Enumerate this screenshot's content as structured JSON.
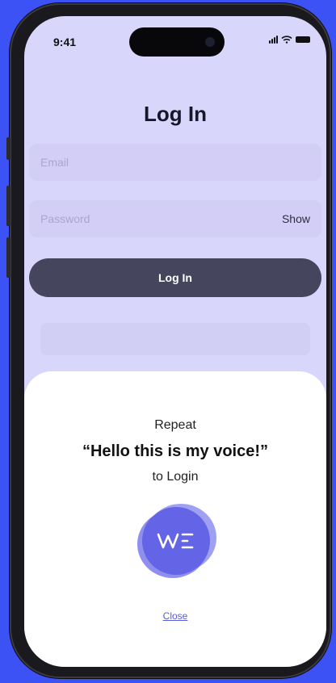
{
  "status_bar": {
    "time": "9:41"
  },
  "page": {
    "title": "Log In"
  },
  "form": {
    "email_placeholder": "Email",
    "password_placeholder": "Password",
    "show_label": "Show",
    "login_label": "Log In"
  },
  "voice_sheet": {
    "repeat_text": "Repeat",
    "phrase": "“Hello this is my voice!”",
    "to_login_text": "to Login",
    "logo_text": "WE",
    "close_label": "Close"
  },
  "colors": {
    "background": "#3d52f5",
    "screen": "#d9d6fb",
    "button": "#45455e",
    "accent": "#5a5cd6"
  }
}
